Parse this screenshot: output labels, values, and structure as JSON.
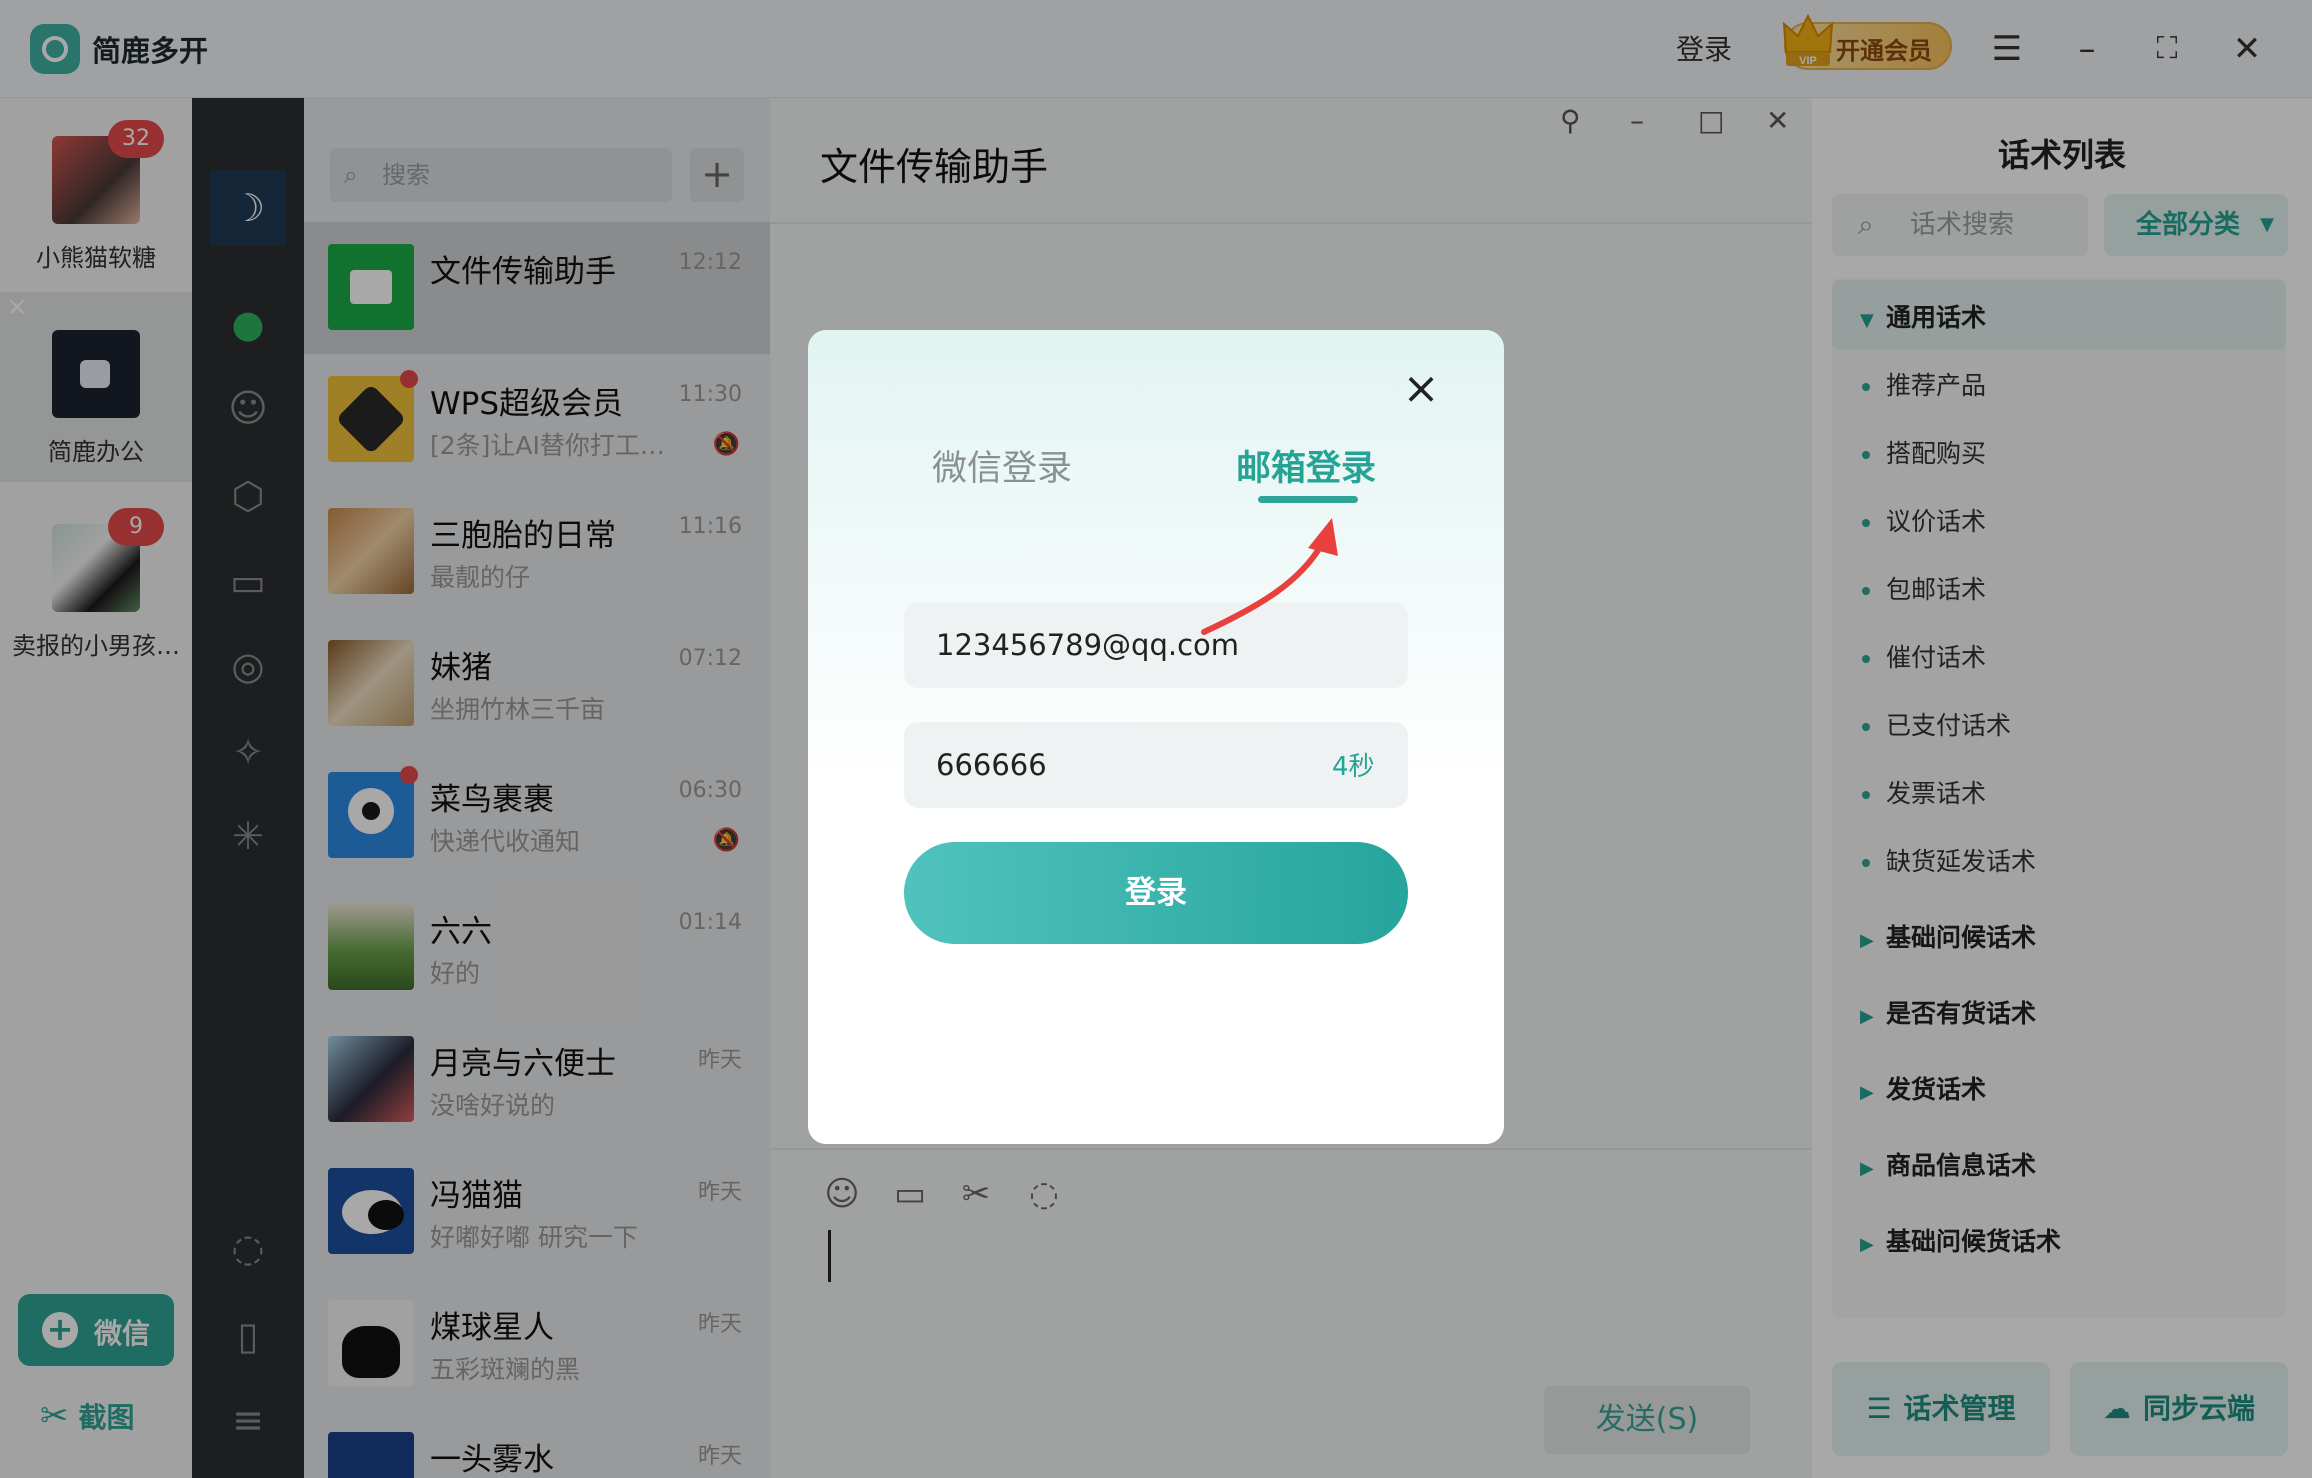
{
  "app": {
    "title": "简鹿多开",
    "login_label": "登录",
    "vip_label": "开通会员",
    "vip_badge": "VIP"
  },
  "accounts": [
    {
      "name": "小熊猫软糖",
      "badge": "32",
      "active": false
    },
    {
      "name": "简鹿办公",
      "badge": null,
      "active": true
    },
    {
      "name": "卖报的小男孩…",
      "badge": "9",
      "active": false
    }
  ],
  "account_actions": {
    "add_wechat": "微信",
    "screenshot": "截图"
  },
  "chat_list": {
    "search_placeholder": "搜索",
    "items": [
      {
        "name": "文件传输助手",
        "time": "12:12",
        "message": "",
        "muted": false
      },
      {
        "name": "WPS超级会员",
        "time": "11:30",
        "message": "[2条]让AI替你打工…",
        "muted": true
      },
      {
        "name": "三胞胎的日常",
        "time": "11:16",
        "message": "最靓的仔",
        "muted": false
      },
      {
        "name": "妹猪",
        "time": "07:12",
        "message": "坐拥竹林三千亩",
        "muted": false
      },
      {
        "name": "菜鸟裹裹",
        "time": "06:30",
        "message": "快递代收通知",
        "muted": true
      },
      {
        "name": "六六",
        "time": "01:14",
        "message": "好的",
        "muted": false
      },
      {
        "name": "月亮与六便士",
        "time": "昨天",
        "message": "没啥好说的",
        "muted": false
      },
      {
        "name": "冯猫猫",
        "time": "昨天",
        "message": "好嘟好嘟 研究一下",
        "muted": false
      },
      {
        "name": "煤球星人",
        "time": "昨天",
        "message": "五彩斑斓的黑",
        "muted": false
      },
      {
        "name": "一头雾水",
        "time": "昨天",
        "message": "",
        "muted": false
      }
    ]
  },
  "chat": {
    "title": "文件传输助手",
    "send_label": "发送(S)"
  },
  "scripts_panel": {
    "title": "话术列表",
    "search_placeholder": "话术搜索",
    "category_label": "全部分类",
    "open_group": "通用话术",
    "open_items": [
      "推荐产品",
      "搭配购买",
      "议价话术",
      "包邮话术",
      "催付话术",
      "已支付话术",
      "发票话术",
      "缺货延发话术"
    ],
    "groups": [
      "基础问候话术",
      "是否有货话术",
      "发货话术",
      "商品信息话术",
      "基础问候货话术"
    ],
    "manage_label": "话术管理",
    "sync_label": "同步云端"
  },
  "login_modal": {
    "tab_wechat": "微信登录",
    "tab_email": "邮箱登录",
    "email_value": "123456789@qq.com",
    "code_value": "666666",
    "code_timer": "4秒",
    "login_button": "登录"
  },
  "colors": {
    "accent": "#2fa597",
    "badge": "#e54b4b",
    "sidebar": "#2d2e2f"
  }
}
